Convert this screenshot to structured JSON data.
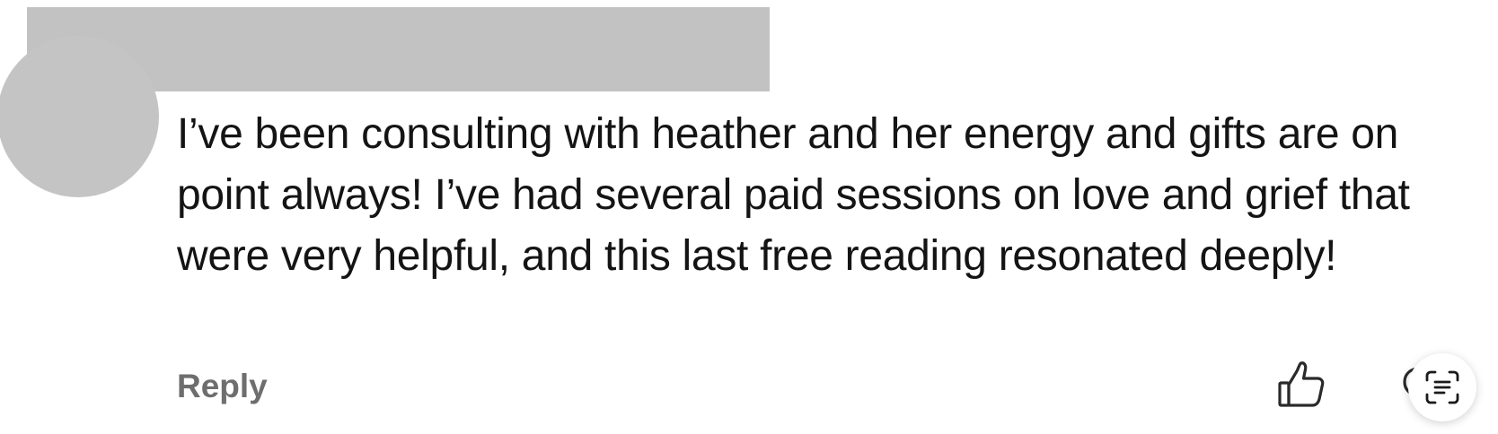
{
  "comment": {
    "author_name_redacted": "",
    "text": "I’ve been consulting with heather and her energy and gifts are on point always! I’ve had several paid sessions on love and grief that were very helpful, and this last free reading resonated deeply!",
    "reply_label": "Reply"
  },
  "icons": {
    "like": "thumbs-up-icon",
    "reply": "comment-bubble-icon",
    "scan": "live-text-scan-icon"
  },
  "colors": {
    "avatar": "#c4c4c4",
    "redaction": "#c2c2c2",
    "text": "#141414",
    "reply": "#6e6e6e"
  }
}
